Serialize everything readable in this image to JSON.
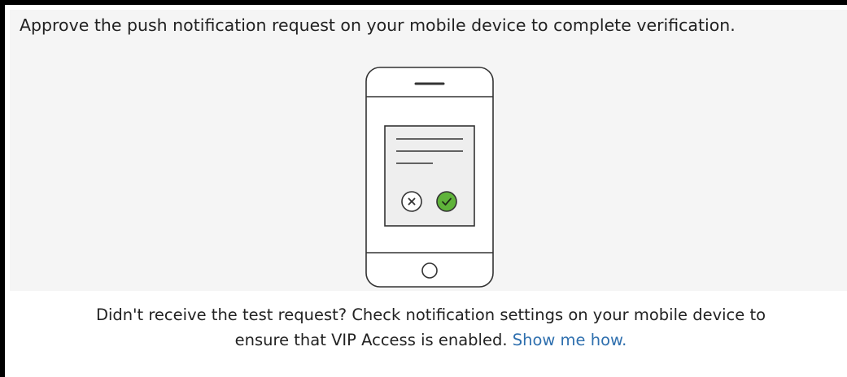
{
  "instruction": {
    "text": "Approve the push notification request on your mobile device to complete verification."
  },
  "illustration": {
    "icons": [
      "phone-icon",
      "reject-x-icon",
      "approve-check-icon"
    ],
    "colors": {
      "outline": "#333333",
      "screen": "#eeeeee",
      "approve_fill": "#5fb33a"
    }
  },
  "help": {
    "line1": "Didn't receive the test request? Check notification settings on your mobile device to",
    "line2": "ensure that VIP Access is enabled.",
    "link_label": "Show me how.",
    "link_color": "#2e6fae"
  }
}
